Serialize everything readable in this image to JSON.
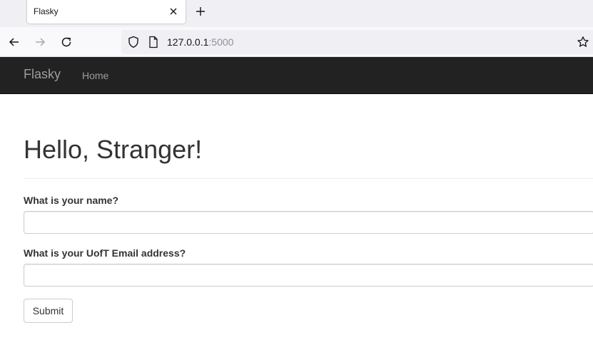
{
  "browser": {
    "tab_title": "Flasky",
    "url_host": "127.0.0.1",
    "url_port": ":5000"
  },
  "navbar": {
    "brand": "Flasky",
    "home_label": "Home"
  },
  "main": {
    "title": "Hello, Stranger!",
    "form": {
      "name_label": "What is your name?",
      "name_value": "",
      "email_label": "What is your UofT Email address?",
      "email_value": "",
      "submit_label": "Submit"
    }
  },
  "icons": [
    "close-icon",
    "plus-icon",
    "arrow-left-icon",
    "arrow-right-icon",
    "reload-icon",
    "shield-icon",
    "page-icon",
    "star-icon"
  ],
  "colors": {
    "navbar_bg": "#222222",
    "navbar_text": "#9d9d9d",
    "text": "#333333",
    "input_border": "#cccccc"
  }
}
